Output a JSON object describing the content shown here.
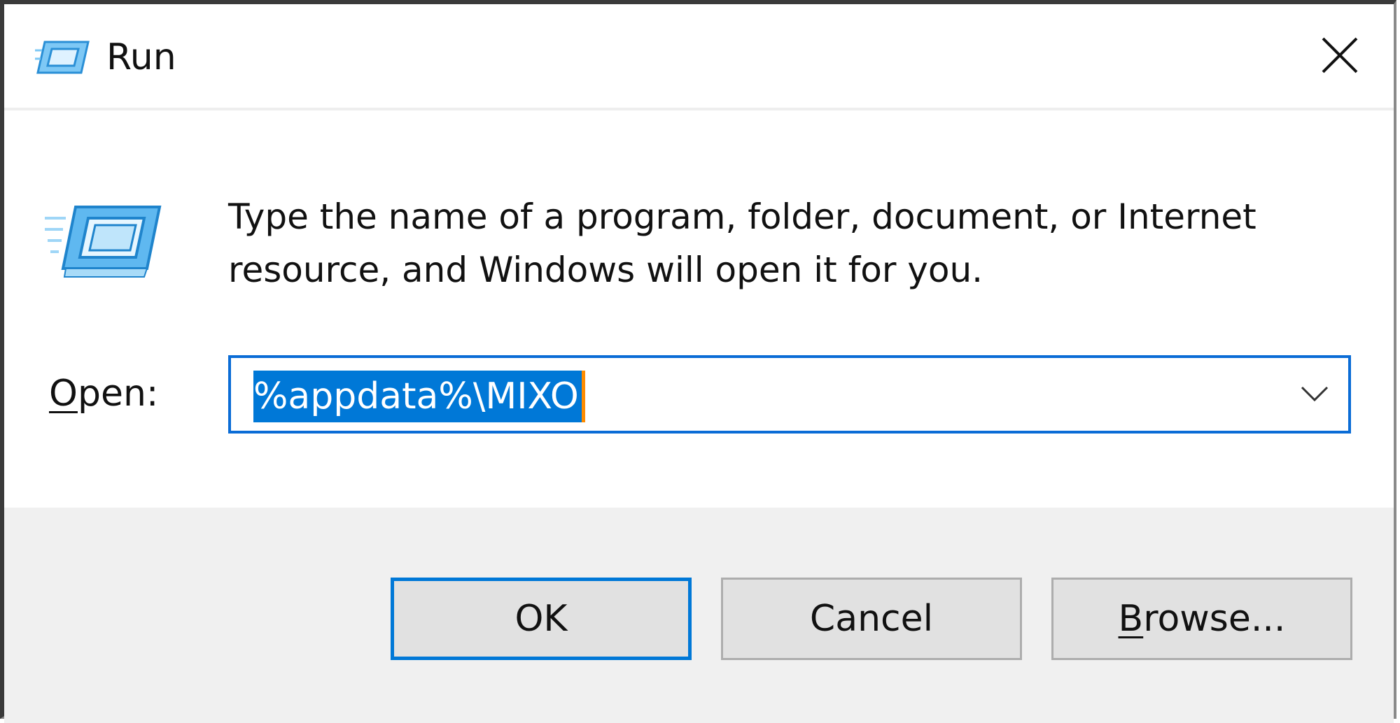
{
  "window": {
    "title": "Run",
    "icon": "run-icon",
    "close_icon": "close-icon"
  },
  "dialog": {
    "description": "Type the name of a program, folder, document, or Internet resource, and Windows will open it for you.",
    "open_label_accel": "O",
    "open_label_rest": "pen:",
    "input_value": "%appdata%\\MIXO",
    "dropdown_icon": "chevron-down-icon"
  },
  "buttons": {
    "ok": "OK",
    "cancel": "Cancel",
    "browse_accel": "B",
    "browse_rest": "rowse..."
  },
  "colors": {
    "accent": "#0078d7",
    "selection": "#0078d7",
    "footer_bg": "#f0f0f0",
    "button_bg": "#e1e1e1"
  }
}
